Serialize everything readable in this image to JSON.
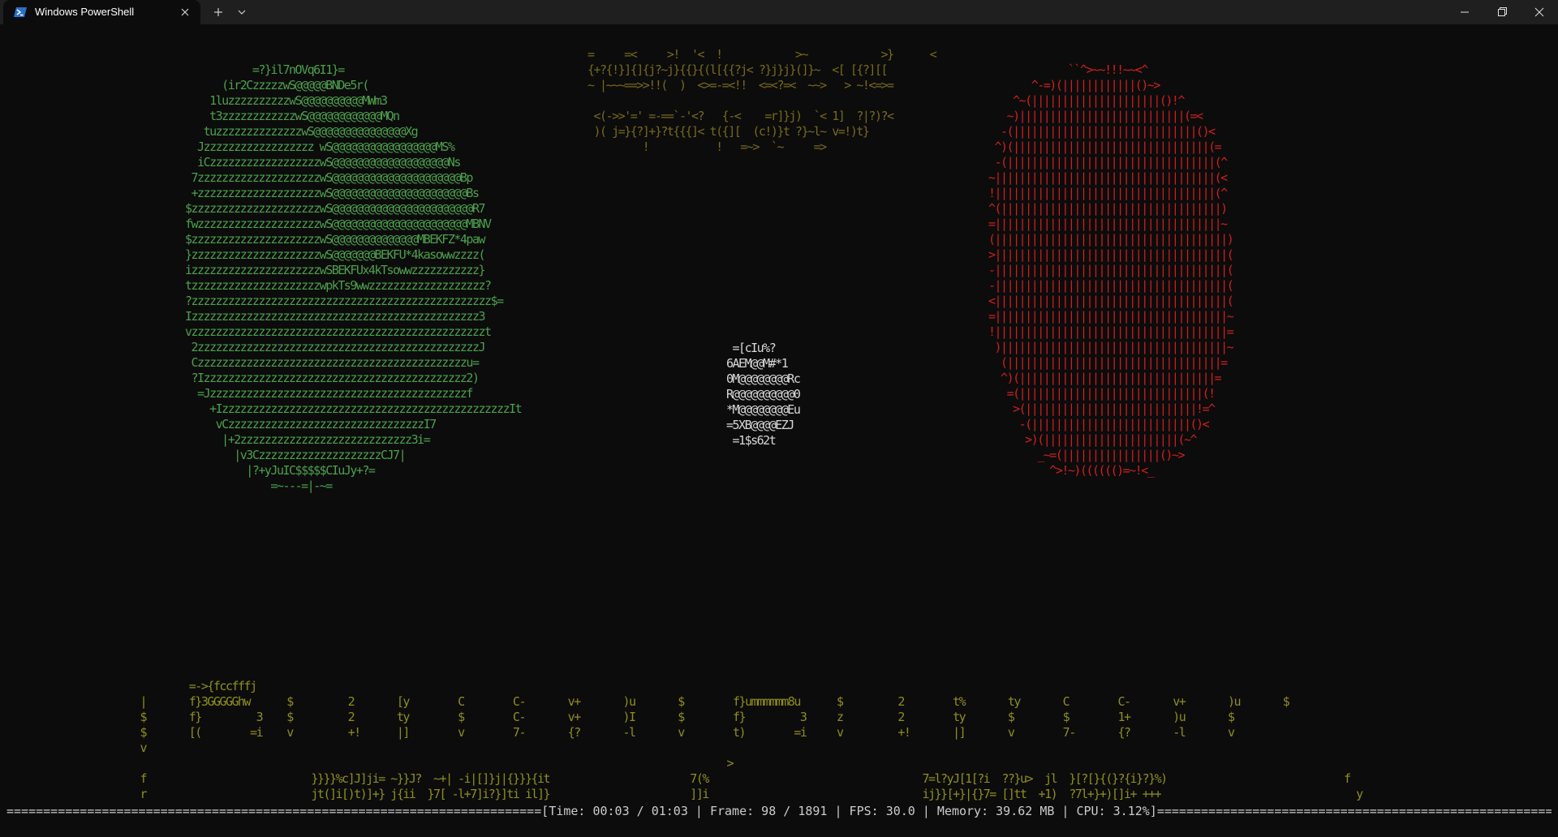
{
  "window": {
    "tab_title": "Windows PowerShell",
    "icons": {
      "app": "powershell-icon",
      "close_tab": "close-icon",
      "new_tab": "plus-icon",
      "dropdown": "chevron-down-icon",
      "minimize": "minimize-icon",
      "maximize": "restore-icon",
      "close_window": "close-icon"
    }
  },
  "colors": {
    "background": "#0c0c0c",
    "titlebar": "#1f1f1f",
    "green_art": "#4ca04c",
    "red_art": "#d21f1f",
    "yellow_art": "#8f8f1c",
    "status_text": "#cccccc"
  },
  "ascii_art": {
    "green": "           =?}il7nOVq6I1}=\n      (ir2CzzzzzwS@@@@@BNDe5r(\n    1luzzzzzzzzzzwS@@@@@@@@@@MWm3\n    t3zzzzzzzzzzzzwS@@@@@@@@@@@@MQn\n   tuzzzzzzzzzzzzzzwS@@@@@@@@@@@@@@@Xg\n  Jzzzzzzzzzzzzzzzzzz wS@@@@@@@@@@@@@@@@@MS%\n  iCzzzzzzzzzzzzzzzzzzwS@@@@@@@@@@@@@@@@@@@Ns\n 7zzzzzzzzzzzzzzzzzzzzwS@@@@@@@@@@@@@@@@@@@@@Bp\n +zzzzzzzzzzzzzzzzzzzzwS@@@@@@@@@@@@@@@@@@@@@@Bs\n$zzzzzzzzzzzzzzzzzzzzzwS@@@@@@@@@@@@@@@@@@@@@@@R7\nfwzzzzzzzzzzzzzzzzzzzzwS@@@@@@@@@@@@@@@@@@@@@@MBNV\n$zzzzzzzzzzzzzzzzzzzzzwS@@@@@@@@@@@@@@MBEKFZ*4paw\n}zzzzzzzzzzzzzzzzzzzzzwS@@@@@@@BEKFU*4kasowwzzzz(\nizzzzzzzzzzzzzzzzzzzzzwSBEKFUx4kTsowwzzzzzzzzzzz}\ntzzzzzzzzzzzzzzzzzzzzzwpkTs9wwzzzzzzzzzzzzzzzzzzz?\n?zzzzzzzzzzzzzzzzzzzzzzzzzzzzzzzzzzzzzzzzzzzzzzzzz$=\nIzzzzzzzzzzzzzzzzzzzzzzzzzzzzzzzzzzzzzzzzzzzzzzz3\nvzzzzzzzzzzzzzzzzzzzzzzzzzzzzzzzzzzzzzzzzzzzzzzzzt\n 2zzzzzzzzzzzzzzzzzzzzzzzzzzzzzzzzzzzzzzzzzzzzzzJ\n Czzzzzzzzzzzzzzzzzzzzzzzzzzzzzzzzzzzzzzzzzzzzu=\n ?Izzzzzzzzzzzzzzzzzzzzzzzzzzzzzzzzzzzzzzzzzzz2)\n  =Jzzzzzzzzzzzzzzzzzzzzzzzzzzzzzzzzzzzzzzzzzzf\n    +IzzzzzzzzzzzzzzzzzzzzzzzzzzzzzzzzzzzzzzzzzzzzzzzIt\n     vCzzzzzzzzzzzzzzzzzzzzzzzzzzzzzzzzI7\n      |+2zzzzzzzzzzzzzzzzzzzzzzzzzzzz3i=\n        |v3CzzzzzzzzzzzzzzzzzzzzCJ7|\n          |?+yJuIC$$$$$CIuJy+?=\n              =~---=|-~=",
    "brackets": "=     =<     >!  '<  !            >~            >}      <\n{+?{!}]{]{j?~j}{{}{(l[{{?j< ?}j}j}(]}~  <[ [{?][[\n~ |~~~==>>!!(  )  <>=-=<!!  <=<?=<  ~~>   > ~!<=>=\n\n <(->>'=' =-==`-'<?   {-<    =r]}j)  `< 1]  ?|?)?<\n )( j=}{?]+}?t{{{]< t({][  (c!)}t ?}~l~ v=!)t}\n         !           !   =~>  `~     =>",
    "center": " =[cIu%?\n6AEM@@M#*1\n0M@@@@@@@@Rc\nR@@@@@@@@@@0\n*M@@@@@@@@Eu\n=5XB@@@@EZJ\n =1$s62t",
    "red": "             ``^>~~!!!~~<^\n       ^-=)(||||||||||||()~>\n    ^~(|||||||||||||||||||||()!^\n   ~)|||||||||||||||||||||||||||(=<\n  -(||||||||||||||||||||||||||||||()<\n ^)(||||||||||||||||||||||||||||||||(=\n -(||||||||||||||||||||||||||||||||||(^\n~||||||||||||||||||||||||||||||||||||(<\n!||||||||||||||||||||||||||||||||||||(^\n^(||||||||||||||||||||||||||||||||||||)\n=|||||||||||||||||||||||||||||||||||||~\n(||||||||||||||||||||||||||||||||||||||)\n>||||||||||||||||||||||||||||||||||||||(\n-||||||||||||||||||||||||||||||||||||||(\n-||||||||||||||||||||||||||||||||||||||(\n<||||||||||||||||||||||||||||||||||||||(\n=||||||||||||||||||||||||||||||||||||||~\n!||||||||||||||||||||||||||||||||||||||=\n )|||||||||||||||||||||||||||||||||||||~\n  (|||||||||||||||||||||||||||||||||||=\n  ^)(||||||||||||||||||||||||||||||||=\n   =(||||||||||||||||||||||||||||||(!\n    >(||||||||||||||||||||||||||||!=^\n     -(||||||||||||||||||||||||||()<\n      >)(||||||||||||||||||||||(~^\n        _~=(||||||||||||||||()~>\n          ^>!~)(((((()=~!<_",
    "bottom": "         =->{fccfffj\n |       f}3GGGGGhw      $         2       [y        C        C-       v+       )u       $        f}ummmmmm8u      $         2        t%       ty       C        C-       v+       )u       $\n $       f}         3    $         2       ty        $        C-       v+       )I       $        f}         3     z         2        ty       $        $        1+       )u       $\n $       [(        =i    v         +!      |]        v        7-       {?       -l       v        t)        =i     v         +!       |]       v        7-       {?       -l       v\n v\n                                                                                                 >\n f                           }}}}%c]J]ji= ~}}J?  ~+| -i|[]}j|{}}}{it                       7(%                                   7=l?yJ[1[?i  ??}u>  jl  }[?[}{(}?{i}?}%)                             f\n r                           jt(]i[)t)]+} j{ii  }7[ -l+7]i?}]ti il]}                       ]]i                                   ij}}[+}|{}7= []tt  +1)  ?7l+}+)[]i+ +++                                y"
  },
  "status": {
    "text": "=========================================================================[Time: 00:03 / 01:03 | Frame: 98 / 1891 | FPS: 30.0 | Memory:  39.62 MB | CPU:  3.12%]================================================================================="
  }
}
